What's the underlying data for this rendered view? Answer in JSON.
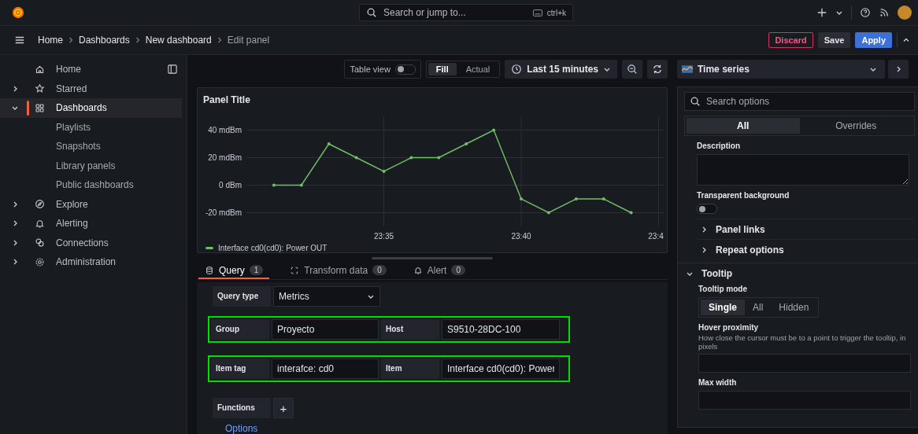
{
  "topbar": {
    "search_placeholder": "Search or jump to...",
    "shortcut": "ctrl+k"
  },
  "breadcrumbs": [
    {
      "label": "Home",
      "current": false
    },
    {
      "label": "Dashboards",
      "current": false
    },
    {
      "label": "New dashboard",
      "current": false
    },
    {
      "label": "Edit panel",
      "current": true
    }
  ],
  "actions": [
    {
      "label": "Discard",
      "kind": "danger"
    },
    {
      "label": "Save",
      "kind": "secondary"
    },
    {
      "label": "Apply",
      "kind": "primary"
    }
  ],
  "sidebar": {
    "items": [
      {
        "label": "Home",
        "expandable": false,
        "selected": false
      },
      {
        "label": "Starred",
        "expandable": true,
        "expanded": false,
        "selected": false
      },
      {
        "label": "Dashboards",
        "expandable": true,
        "expanded": true,
        "selected": true,
        "children": [
          {
            "label": "Playlists"
          },
          {
            "label": "Snapshots"
          },
          {
            "label": "Library panels"
          },
          {
            "label": "Public dashboards"
          }
        ]
      },
      {
        "label": "Explore",
        "expandable": true,
        "expanded": false,
        "selected": false
      },
      {
        "label": "Alerting",
        "expandable": true,
        "expanded": false,
        "selected": false
      },
      {
        "label": "Connections",
        "expandable": true,
        "expanded": false,
        "selected": false
      },
      {
        "label": "Administration",
        "expandable": true,
        "expanded": false,
        "selected": false
      }
    ]
  },
  "toolbar": {
    "table_view": {
      "label": "Table view",
      "on": false
    },
    "view_modes": [
      {
        "label": "Fill",
        "selected": true
      },
      {
        "label": "Actual",
        "selected": false
      }
    ],
    "time_range": "Last 15 minutes",
    "visualization": "Time series"
  },
  "panel": {
    "title": "Panel Title",
    "chart_data": {
      "type": "line",
      "grid": true,
      "categories": [
        null,
        null,
        null,
        null,
        "23:35",
        null,
        null,
        null,
        null,
        "23:40",
        null,
        null,
        null,
        null,
        "23:4"
      ],
      "ylim": [
        -30,
        50
      ],
      "yticks": [
        {
          "value": 40,
          "label": "40 mdBm"
        },
        {
          "value": 20,
          "label": "20 mdBm"
        },
        {
          "value": 0,
          "label": "0 dBm"
        },
        {
          "value": -20,
          "label": "-20 mdBm"
        }
      ],
      "series": [
        {
          "name": "Interface cd0(cd0): Power OUT",
          "color": "#73bf69",
          "values": [
            0,
            0,
            30,
            20,
            10,
            20,
            20,
            30,
            40,
            -10,
            -20,
            -10,
            -10,
            -20,
            null
          ]
        }
      ]
    }
  },
  "query_tabs": [
    {
      "label": "Query",
      "count": "1",
      "selected": true
    },
    {
      "label": "Transform data",
      "count": "0",
      "selected": false
    },
    {
      "label": "Alert",
      "count": "0",
      "selected": false
    }
  ],
  "query": {
    "rows": [
      {
        "kind": "select",
        "highlighted": false,
        "fields": [
          {
            "label": "Query type",
            "value": "Metrics"
          }
        ]
      },
      {
        "kind": "inputs",
        "highlighted": true,
        "fields": [
          {
            "label": "Group",
            "value": "Proyecto"
          },
          {
            "label": "Host",
            "value": "S9510-28DC-100"
          }
        ]
      },
      {
        "kind": "inputs",
        "highlighted": true,
        "fields": [
          {
            "label": "Item tag",
            "value": "interafce: cd0"
          },
          {
            "label": "Item",
            "value": "Interface cd0(cd0): Power"
          }
        ]
      }
    ],
    "functions_label": "Functions",
    "add_symbol": "+",
    "options_link": "Options"
  },
  "options": {
    "search_placeholder": "Search options",
    "tabs": [
      {
        "label": "All",
        "selected": true
      },
      {
        "label": "Overrides",
        "selected": false
      }
    ],
    "description_label": "Description",
    "transparent": {
      "label": "Transparent background",
      "on": false
    },
    "collapsed_sections": [
      {
        "label": "Panel links",
        "expanded": false
      },
      {
        "label": "Repeat options",
        "expanded": false
      }
    ],
    "tooltip": {
      "title": "Tooltip",
      "expanded": true,
      "mode_label": "Tooltip mode",
      "modes": [
        {
          "label": "Single",
          "selected": true
        },
        {
          "label": "All",
          "selected": false
        },
        {
          "label": "Hidden",
          "selected": false
        }
      ],
      "hover_label": "Hover proximity",
      "hover_description": "How close the cursor must be to a point to trigger the tooltip, in pixels",
      "max_width_label": "Max width"
    }
  }
}
